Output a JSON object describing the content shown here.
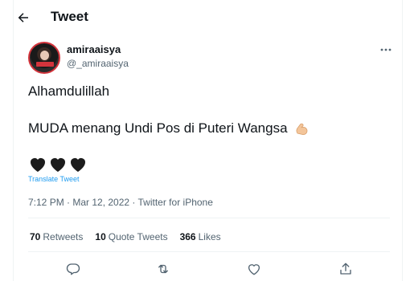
{
  "header": {
    "title": "Tweet"
  },
  "author": {
    "name": "amiraaisya",
    "handle": "@_amiraaisya"
  },
  "tweet": {
    "line1": "Alhamdulillah",
    "line2": "MUDA menang Undi Pos di Puteri Wangsa",
    "emoji_line2": "flexed-biceps-icon",
    "hearts": [
      "black-heart-icon",
      "black-heart-icon",
      "black-heart-icon"
    ],
    "translate_label": "Translate Tweet",
    "meta": "7:12 PM · Mar 12, 2022 · Twitter for iPhone"
  },
  "stats": {
    "retweets_count": "70",
    "retweets_label": "Retweets",
    "quotes_count": "10",
    "quotes_label": "Quote Tweets",
    "likes_count": "366",
    "likes_label": "Likes"
  },
  "colors": {
    "accent": "#1d9bf0",
    "secondary_text": "#536471",
    "primary_text": "#0f1419",
    "border": "#eff3f4"
  }
}
